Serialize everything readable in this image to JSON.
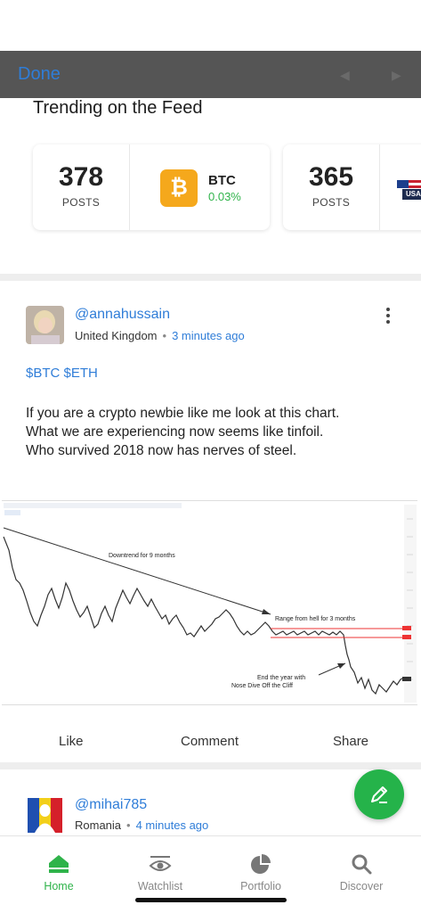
{
  "topbar": {
    "done_label": "Done",
    "prev_arrow": "◀",
    "next_arrow": "▶"
  },
  "trending": {
    "title": "Trending on the Feed",
    "card1": {
      "count": "378",
      "label": "POSTS"
    },
    "btc": {
      "icon_glyph": "₿",
      "symbol": "BTC",
      "change": "0.03%"
    },
    "card2": {
      "count": "365",
      "label": "POSTS"
    },
    "partial_flag_label": "USA"
  },
  "post1": {
    "username": "@annahussain",
    "location": "United Kingdom",
    "time": "3 minutes ago",
    "tags": "$BTC $ETH",
    "text_lines": [
      "If you are a crypto newbie like me look at this chart.",
      "What we are experiencing now seems like tinfoil.",
      "Who survived 2018 now has nerves of steel."
    ],
    "chart_annotations": {
      "a1": "Downtrend for 9 months",
      "a2": "Range from hell for 3 months",
      "a3a": "End the year with",
      "a3b": "Nose Dive Off the Cliff"
    },
    "actions": {
      "like": "Like",
      "comment": "Comment",
      "share": "Share"
    }
  },
  "post2": {
    "username": "@mihai785",
    "location": "Romania",
    "time": "4 minutes ago"
  },
  "tabs": [
    {
      "label": "Home",
      "icon": "home-icon",
      "active": true
    },
    {
      "label": "Watchlist",
      "icon": "eye-icon",
      "active": false
    },
    {
      "label": "Portfolio",
      "icon": "pie-chart-icon",
      "active": false
    },
    {
      "label": "Discover",
      "icon": "search-icon",
      "active": false
    }
  ],
  "colors": {
    "accent_blue": "#2f7dd8",
    "green": "#25b34a",
    "btc_orange": "#f5a81c",
    "topbar": "#555555"
  }
}
